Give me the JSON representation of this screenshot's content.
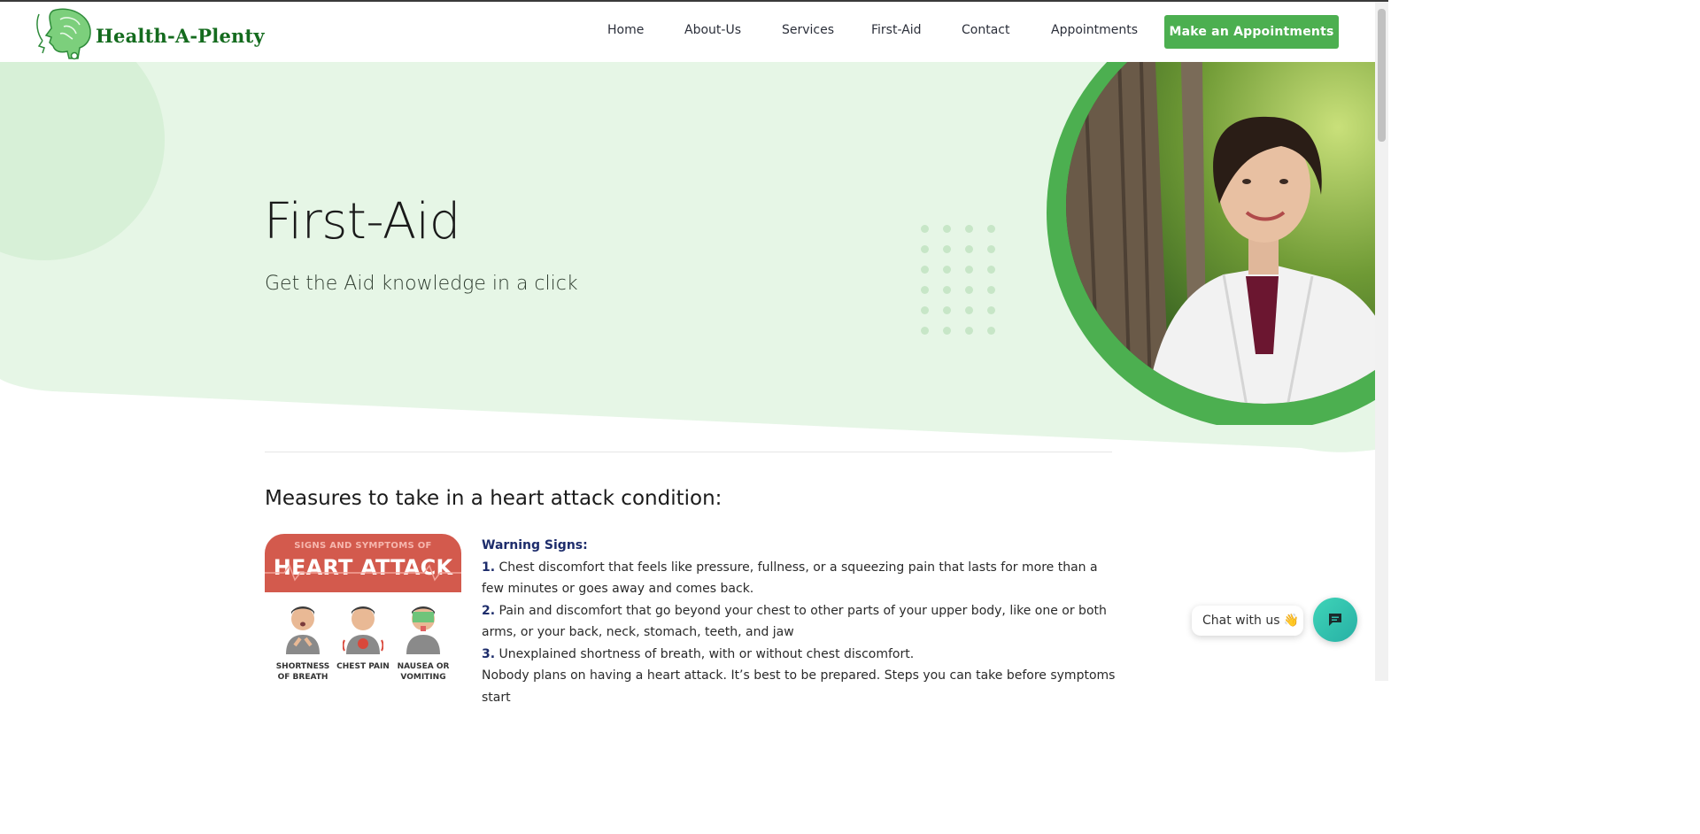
{
  "brand": {
    "name": "Health-A-Plenty",
    "logo_icon": "head-profile-icon",
    "color": "#146b1e"
  },
  "nav": {
    "items": [
      {
        "label": "Home"
      },
      {
        "label": "About-Us"
      },
      {
        "label": "Services"
      },
      {
        "label": "First-Aid"
      },
      {
        "label": "Contact"
      },
      {
        "label": "Appointments"
      }
    ],
    "cta_label": "Make an Appointments",
    "cta_color": "#4caf50"
  },
  "hero": {
    "title": "First-Aid",
    "subtitle": "Get the Aid knowledge in a click",
    "background_color": "#e6f6e6",
    "ring_color": "#4caf50"
  },
  "section": {
    "title": "Measures to take in a heart attack condition:"
  },
  "infographic": {
    "top_text": "SIGNS AND SYMPTOMS OF",
    "main_text": "HEART ATTACK",
    "captions": [
      {
        "line1": "SHORTNESS",
        "line2": "OF BREATH"
      },
      {
        "line1": "CHEST PAIN",
        "line2": ""
      },
      {
        "line1": "NAUSEA OR",
        "line2": "VOMITING"
      }
    ]
  },
  "content": {
    "heading": "Warning Signs:",
    "items": [
      {
        "num": "1.",
        "text": " Chest discomfort that feels like pressure, fullness, or a squeezing pain that lasts for more than a few minutes or goes away and comes back."
      },
      {
        "num": "2.",
        "text": " Pain and discomfort that go beyond your chest to other parts of your upper body, like one or both arms, or your back, neck, stomach, teeth, and jaw"
      },
      {
        "num": "3.",
        "text": " Unexplained shortness of breath, with or without chest discomfort."
      }
    ],
    "closing": "Nobody plans on having a heart attack. It’s best to be prepared. Steps you can take before symptoms start"
  },
  "chat": {
    "label": "Chat with us 👋",
    "icon": "chat-bubble-icon"
  }
}
